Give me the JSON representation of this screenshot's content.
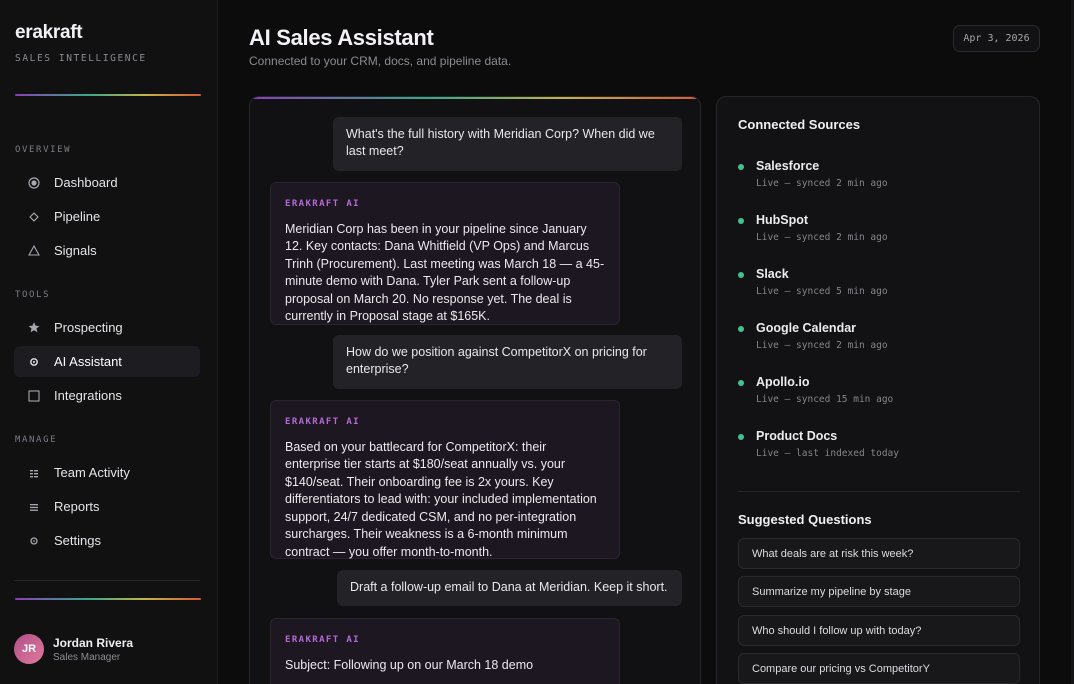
{
  "brand": {
    "name": "erakraft",
    "tagline": "SALES INTELLIGENCE"
  },
  "nav": {
    "overview_label": "OVERVIEW",
    "tools_label": "TOOLS",
    "manage_label": "MANAGE",
    "items": [
      {
        "label": "Dashboard",
        "icon": "radio-icon"
      },
      {
        "label": "Pipeline",
        "icon": "diamond-icon"
      },
      {
        "label": "Signals",
        "icon": "triangle-icon"
      },
      {
        "label": "Prospecting",
        "icon": "star-icon"
      },
      {
        "label": "AI Assistant",
        "icon": "gear-icon",
        "active": true
      },
      {
        "label": "Integrations",
        "icon": "square-icon"
      },
      {
        "label": "Team Activity",
        "icon": "grid-icon"
      },
      {
        "label": "Reports",
        "icon": "lines-icon"
      },
      {
        "label": "Settings",
        "icon": "gear-icon"
      }
    ]
  },
  "user": {
    "initials": "JR",
    "name": "Jordan Rivera",
    "role": "Sales Manager"
  },
  "header": {
    "title": "AI Sales Assistant",
    "subtitle": "Connected to your CRM, docs, and pipeline data.",
    "date": "Apr 3, 2026"
  },
  "chat": {
    "ai_tag": "ERAKRAFT AI",
    "messages": [
      {
        "role": "user",
        "text": "What's the full history with Meridian Corp? When did we last meet?"
      },
      {
        "role": "ai",
        "text": "Meridian Corp has been in your pipeline since January 12. Key contacts: Dana Whitfield (VP Ops) and Marcus Trinh (Procurement). Last meeting was March 18 — a 45-minute demo with Dana. Tyler Park sent a follow-up proposal on March 20. No response yet. The deal is currently in Proposal stage at $165K."
      },
      {
        "role": "user",
        "text": "How do we position against CompetitorX on pricing for enterprise?"
      },
      {
        "role": "ai",
        "text": "Based on your battlecard for CompetitorX: their enterprise tier starts at $180/seat annually vs. your $140/seat. Their onboarding fee is 2x yours. Key differentiators to lead with: your included implementation support, 24/7 dedicated CSM, and no per-integration surcharges. Their weakness is a 6-month minimum contract — you offer month-to-month."
      },
      {
        "role": "user",
        "text": "Draft a follow-up email to Dana at Meridian. Keep it short."
      },
      {
        "role": "ai",
        "text": "Subject: Following up on our March 18 demo"
      }
    ]
  },
  "sources": {
    "title": "Connected Sources",
    "items": [
      {
        "name": "Salesforce",
        "status": "Live — synced 2 min ago"
      },
      {
        "name": "HubSpot",
        "status": "Live — synced 2 min ago"
      },
      {
        "name": "Slack",
        "status": "Live — synced 5 min ago"
      },
      {
        "name": "Google Calendar",
        "status": "Live — synced 2 min ago"
      },
      {
        "name": "Apollo.io",
        "status": "Live — synced 15 min ago"
      },
      {
        "name": "Product Docs",
        "status": "Live — last indexed today"
      }
    ],
    "status_color": "#42c28f"
  },
  "suggested": {
    "title": "Suggested Questions",
    "items": [
      "What deals are at risk this week?",
      "Summarize my pipeline by stage",
      "Who should I follow up with today?",
      "Compare our pricing vs CompetitorY"
    ]
  },
  "colors": {
    "accent_purple": "#b36ad6",
    "background": "#0c0c0d"
  }
}
